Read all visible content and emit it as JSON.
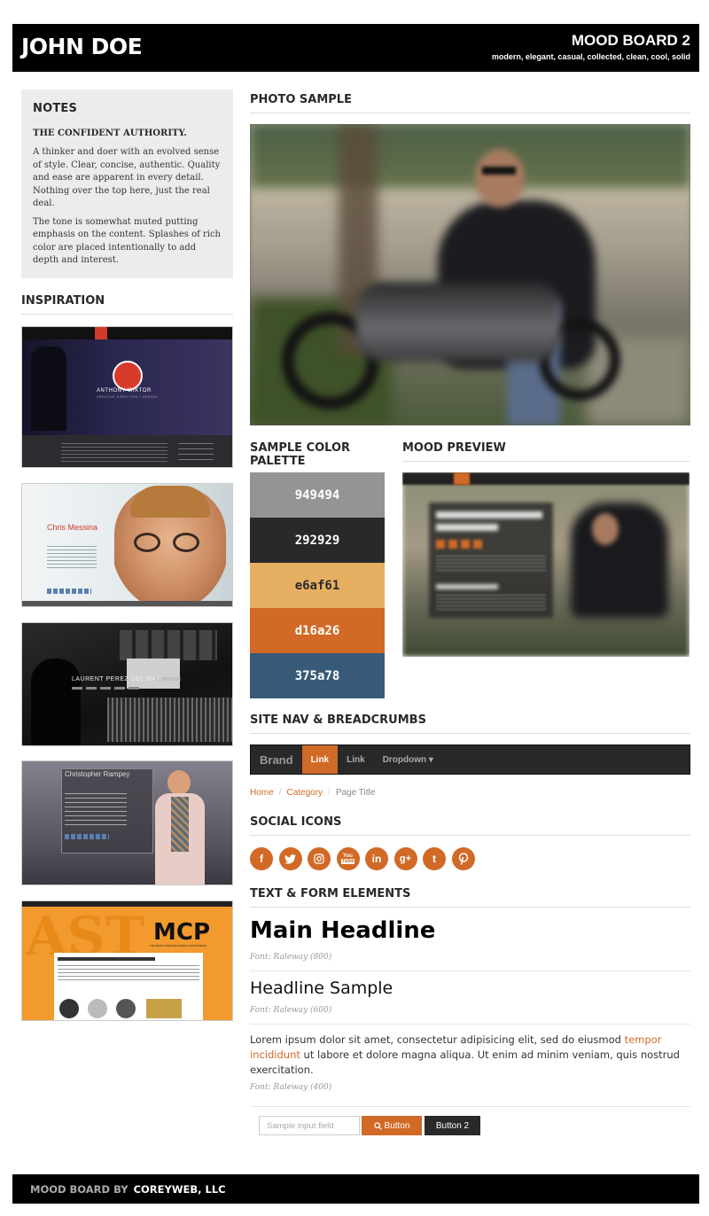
{
  "header": {
    "name": "JOHN DOE",
    "board_title": "MOOD BOARD 2",
    "keywords": "modern, elegant, casual, collected, clean, cool, solid"
  },
  "notes": {
    "title": "NOTES",
    "lead": "THE CONFIDENT AUTHORITY.",
    "p1": "A thinker and doer with an evolved sense of style. Clear, concise, authentic. Quality and ease are apparent in every detail. Nothing over the top here, just the real deal.",
    "p2": "The tone is somewhat muted putting emphasis on the content. Splashes of rich color are placed intentionally to add depth and interest."
  },
  "inspiration": {
    "title": "INSPIRATION",
    "items": [
      {
        "name": "ANTHONY WIKTOR",
        "sub": "CREATIVE DIRECTION + DESIGN"
      },
      {
        "name": "Chris Messina"
      },
      {
        "name": "LAURENT PEREZ DEL MAR",
        "sub": "COMPOSER"
      },
      {
        "name": "Christopher Rampey"
      },
      {
        "name": "MCP",
        "sub": "THE MOST CREATIVE PEOPLE IN BUSINESS"
      }
    ]
  },
  "sections": {
    "photo": "PHOTO SAMPLE",
    "palette": "SAMPLE COLOR PALETTE",
    "mood": "MOOD PREVIEW",
    "nav": "SITE NAV & BREADCRUMBS",
    "social": "SOCIAL ICONS",
    "text_form": "TEXT & FORM ELEMENTS"
  },
  "palette": [
    {
      "label": "949494",
      "color": "#949494",
      "text": "#ffffff"
    },
    {
      "label": "292929",
      "color": "#292929",
      "text": "#ffffff"
    },
    {
      "label": "e6af61",
      "color": "#e6af61",
      "text": "#292929"
    },
    {
      "label": "d16a26",
      "color": "#d16a26",
      "text": "#ffffff"
    },
    {
      "label": "375a78",
      "color": "#375a78",
      "text": "#ffffff"
    }
  ],
  "navbar": {
    "brand": "Brand",
    "items": [
      "Link",
      "Link",
      "Dropdown ▾"
    ]
  },
  "breadcrumb": {
    "home": "Home",
    "category": "Category",
    "current": "Page Title"
  },
  "social_icons": [
    "facebook-icon",
    "twitter-icon",
    "instagram-icon",
    "youtube-icon",
    "linkedin-icon",
    "google-plus-icon",
    "tumblr-icon",
    "pinterest-icon"
  ],
  "typography": {
    "main_headline": "Main Headline",
    "main_font": "Font: Raleway (800)",
    "headline_sample": "Headline Sample",
    "headline_font": "Font: Raleway (600)",
    "para_a": "Lorem ipsum dolor sit amet, consectetur adipisicing elit, sed do eiusmod ",
    "para_link": "tempor incididunt",
    "para_b": " ut labore et dolore magna aliqua. Ut enim ad minim veniam, quis nostrud exercitation.",
    "para_font": "Font: Raleway (400)"
  },
  "form": {
    "placeholder": "Sample input field",
    "button1": "Button",
    "button2": "Button 2"
  },
  "footer": {
    "label": "MOOD BOARD BY",
    "company": "COREYWEB, LLC"
  },
  "colors": {
    "accent": "#d16a26",
    "dark": "#292929",
    "gray": "#949494",
    "gold": "#e6af61",
    "blue": "#375a78"
  }
}
